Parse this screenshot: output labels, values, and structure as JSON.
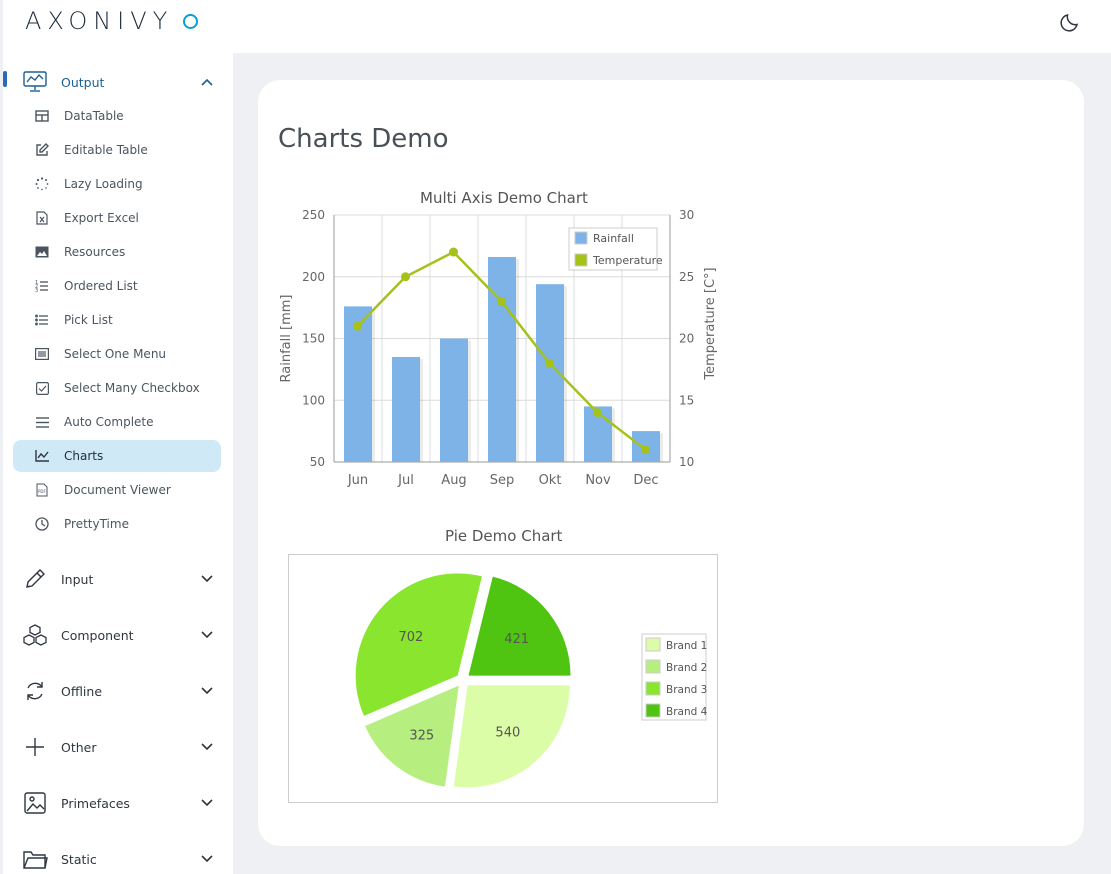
{
  "app": {
    "logo_text": "AXONIVY"
  },
  "sidebar": {
    "output": {
      "label": "Output",
      "items": [
        {
          "label": "DataTable",
          "icon": "table-icon"
        },
        {
          "label": "Editable Table",
          "icon": "edit-icon"
        },
        {
          "label": "Lazy Loading",
          "icon": "spinner-icon"
        },
        {
          "label": "Export Excel",
          "icon": "excel-file-icon"
        },
        {
          "label": "Resources",
          "icon": "image-icon"
        },
        {
          "label": "Ordered List",
          "icon": "ordered-list-icon"
        },
        {
          "label": "Pick List",
          "icon": "list-icon"
        },
        {
          "label": "Select One Menu",
          "icon": "select-menu-icon"
        },
        {
          "label": "Select Many Checkbox",
          "icon": "checkbox-icon"
        },
        {
          "label": "Auto Complete",
          "icon": "bars-icon"
        },
        {
          "label": "Charts",
          "icon": "line-chart-icon",
          "active": true
        },
        {
          "label": "Document Viewer",
          "icon": "pdf-icon"
        },
        {
          "label": "PrettyTime",
          "icon": "clock-icon"
        }
      ]
    },
    "groups": [
      {
        "label": "Input",
        "icon": "pencil-icon"
      },
      {
        "label": "Component",
        "icon": "cubes-icon"
      },
      {
        "label": "Offline",
        "icon": "sync-icon"
      },
      {
        "label": "Other",
        "icon": "plus-icon"
      },
      {
        "label": "Primefaces",
        "icon": "picture-icon"
      },
      {
        "label": "Static",
        "icon": "folder-icon"
      }
    ]
  },
  "main": {
    "title": "Charts Demo"
  },
  "colors": {
    "accent": "#1c5f96",
    "active_bg": "#cfeaf6",
    "bar": "#7eb3e8",
    "line": "#a5c21b"
  },
  "chart_data": [
    {
      "type": "bar",
      "title": "Multi Axis Demo Chart",
      "categories": [
        "Jun",
        "Jul",
        "Aug",
        "Sep",
        "Okt",
        "Nov",
        "Dec"
      ],
      "series": [
        {
          "name": "Rainfall",
          "type": "bar",
          "axis": "left",
          "values": [
            176,
            135,
            150,
            216,
            194,
            95,
            75
          ]
        },
        {
          "name": "Temperature",
          "type": "line",
          "axis": "right",
          "values": [
            21,
            25,
            27,
            23,
            18,
            14,
            11
          ]
        }
      ],
      "ylabel": "Rainfall [mm]",
      "y2label": "Temperature [C°]",
      "ylim": [
        50,
        250
      ],
      "y2lim": [
        10,
        30
      ],
      "yticks": [
        50,
        100,
        150,
        200,
        250
      ],
      "y2ticks": [
        10,
        15,
        20,
        25,
        30
      ],
      "grid": true,
      "legend": "top-right"
    },
    {
      "type": "pie",
      "title": "Pie Demo Chart",
      "labels": [
        "Brand 1",
        "Brand 2",
        "Brand 3",
        "Brand 4"
      ],
      "values": [
        540,
        325,
        702,
        421
      ],
      "colors": [
        "#dcfda8",
        "#b6ef7f",
        "#89e52e",
        "#4fc411"
      ],
      "legend": "right"
    }
  ]
}
